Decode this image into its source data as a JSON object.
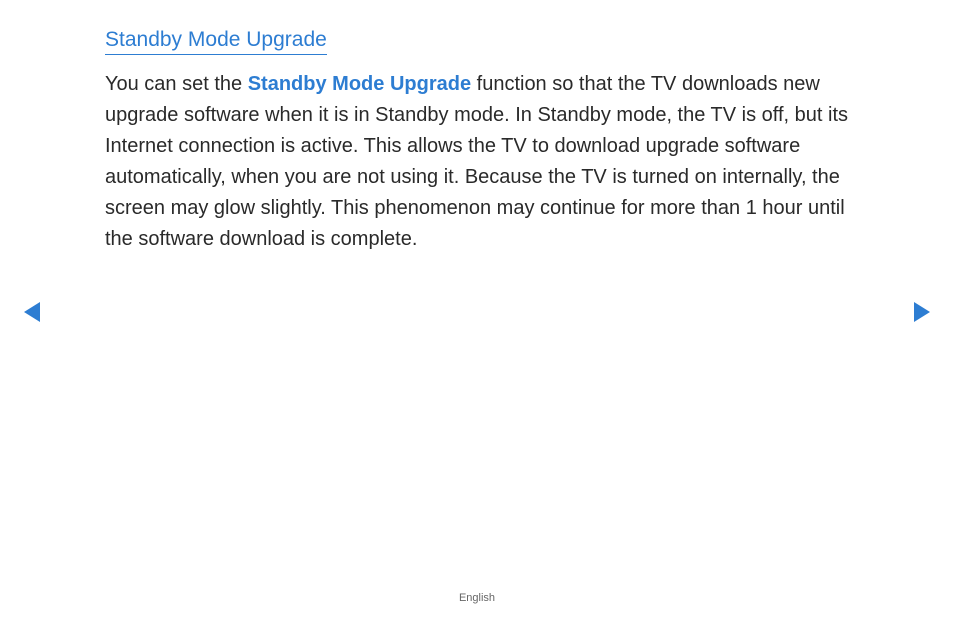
{
  "heading": "Standby Mode Upgrade",
  "body": {
    "prefix": "You can set the ",
    "term": "Standby Mode Upgrade",
    "suffix": " function so that the TV downloads new upgrade software when it is in Standby mode. In Standby mode, the TV is off, but its Internet connection is active. This allows the TV to download upgrade software automatically, when you are not using it. Because the TV is turned on internally, the screen may glow slightly. This phenomenon may continue for more than 1 hour until the software download is complete."
  },
  "footer_language": "English",
  "colors": {
    "accent": "#2d7dd2"
  }
}
